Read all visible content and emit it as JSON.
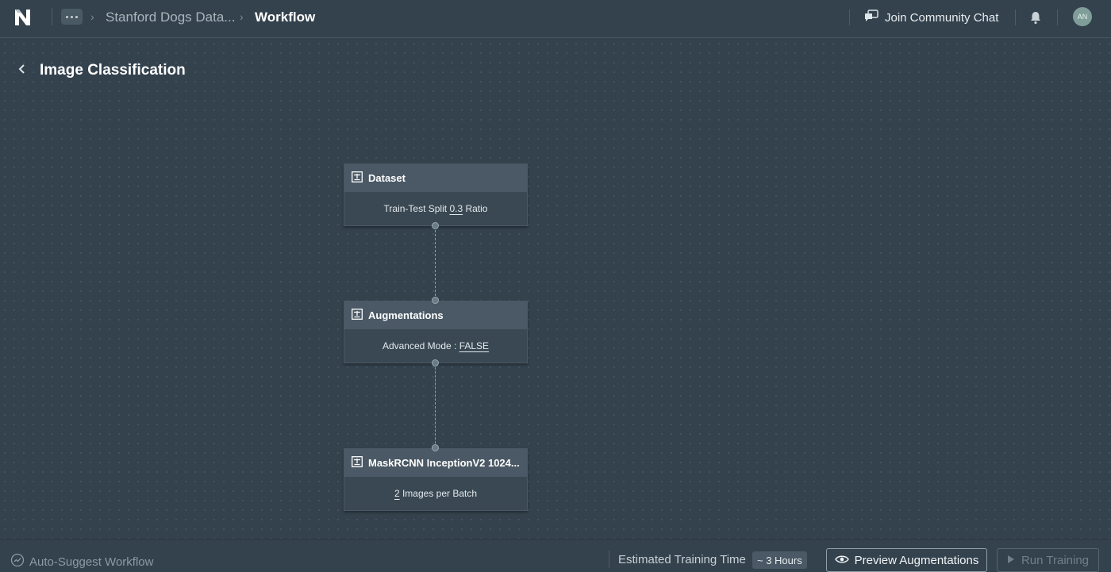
{
  "header": {
    "logo_letter": "N",
    "breadcrumb": [
      {
        "label": "Stanford Dogs Data..."
      },
      {
        "label": "Workflow"
      }
    ],
    "community_chat_label": "Join Community Chat",
    "avatar_initials": "AN"
  },
  "page": {
    "title": "Image Classification"
  },
  "nodes": [
    {
      "title": "Dataset",
      "body_prefix": "Train-Test Split ",
      "body_value": "0.3",
      "body_suffix": " Ratio"
    },
    {
      "title": "Augmentations",
      "body_prefix": "Advanced Mode : ",
      "body_value": "FALSE",
      "body_suffix": ""
    },
    {
      "title": "MaskRCNN InceptionV2 1024...",
      "body_prefix": "",
      "body_value": "2",
      "body_suffix": " Images per Batch"
    }
  ],
  "footer": {
    "auto_suggest_label": "Auto-Suggest Workflow",
    "estimated_label": "Estimated Training Time",
    "estimated_value": "~ 3 Hours",
    "preview_label": "Preview Augmentations",
    "run_label": "Run Training"
  }
}
